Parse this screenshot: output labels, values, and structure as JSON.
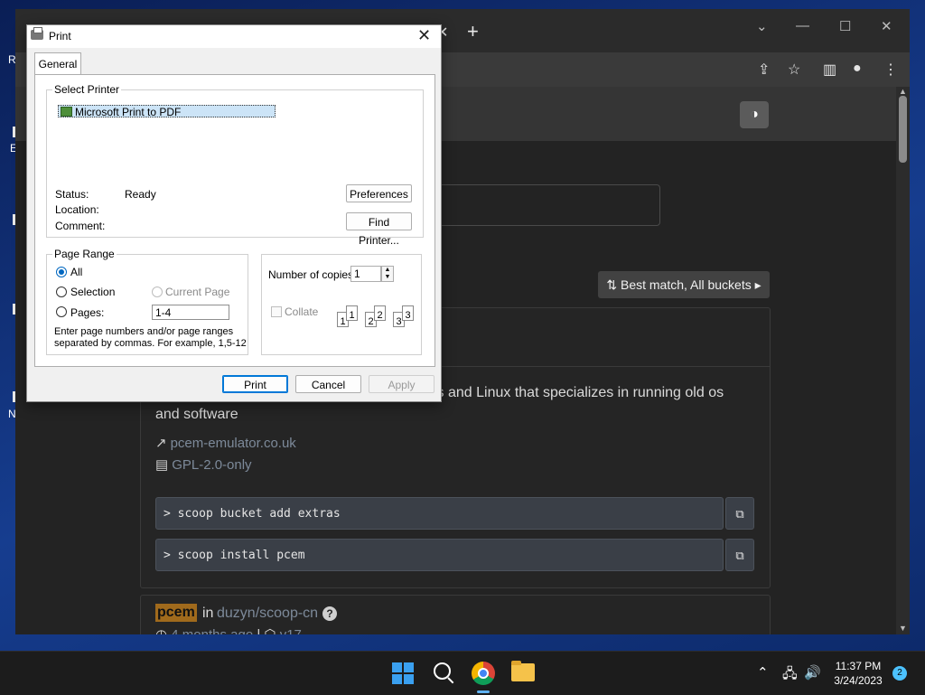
{
  "desktop": {
    "icon_labels": [
      "R",
      "E",
      "N"
    ]
  },
  "browser": {
    "window_controls": {
      "minimize": "—",
      "maximize": "☐",
      "close": "✕",
      "tab_search": "⌄"
    },
    "tab_close": "✕",
    "new_tab": "+",
    "toolbar_icons": {
      "share": "⇪",
      "bookmark": "☆",
      "side_panel": "▥",
      "profile": "●",
      "menu": "⋮"
    }
  },
  "page": {
    "theme_toggle_icon": "◑",
    "sort_button": {
      "icon": "⇅",
      "label": "Best match, All buckets",
      "chevron": "▸"
    },
    "result1": {
      "description_visible": "ws and Linux that specializes in running old os",
      "description_line2": "and software",
      "homepage_icon": "↗",
      "homepage": "pcem-emulator.co.uk",
      "license_icon": "▤",
      "license": "GPL-2.0-only",
      "commands": [
        {
          "prompt": ">",
          "text": "scoop bucket add extras"
        },
        {
          "prompt": ">",
          "text": "scoop install pcem"
        }
      ],
      "copy_icon": "⧉"
    },
    "result2": {
      "name": "pcem",
      "in": "in",
      "bucket": "duzyn/scoop-cn",
      "help_icon": "?",
      "clock_icon": "◷",
      "updated": "4 months ago",
      "separator": "|",
      "version_icon": "⬡",
      "version": "v17"
    }
  },
  "print_dialog": {
    "title": "Print",
    "close": "✕",
    "tab": "General",
    "select_printer": {
      "label": "Select Printer",
      "selected": "Microsoft Print to PDF"
    },
    "status_label": "Status:",
    "status_value": "Ready",
    "location_label": "Location:",
    "comment_label": "Comment:",
    "preferences_button": "Preferences",
    "find_printer_button": "Find Printer...",
    "page_range": {
      "label": "Page Range",
      "all": "All",
      "selection": "Selection",
      "current_page": "Current Page",
      "pages": "Pages:",
      "pages_value": "1-4",
      "hint_line1": "Enter page numbers and/or page ranges",
      "hint_line2": "separated by commas.  For example, 1,5-12"
    },
    "copies": {
      "label": "Number of copies:",
      "value": "1",
      "spin_up": "▲",
      "spin_down": "▼",
      "collate": "Collate",
      "collate_pages": [
        "1",
        "1",
        "2",
        "2",
        "3",
        "3"
      ]
    },
    "buttons": {
      "print": "Print",
      "cancel": "Cancel",
      "apply": "Apply"
    }
  },
  "taskbar": {
    "tray": {
      "chevron": "⌃",
      "network": "🖧",
      "volume": "🔊"
    },
    "time": "11:37 PM",
    "date": "3/24/2023",
    "notifications": "2"
  }
}
